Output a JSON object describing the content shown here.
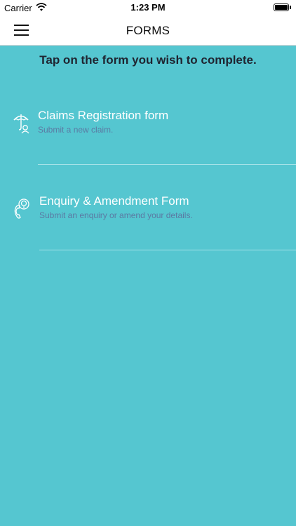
{
  "status_bar": {
    "carrier": "Carrier",
    "time": "1:23 PM",
    "wifi_icon": "wifi-icon",
    "battery_icon": "battery-icon"
  },
  "header": {
    "title": "FORMS",
    "menu_icon": "hamburger-menu-icon"
  },
  "main": {
    "instruction": "Tap on the form you wish to complete.",
    "forms": [
      {
        "title": "Claims Registration form",
        "subtitle": "Submit a new claim.",
        "icon": "umbrella-icon"
      },
      {
        "title": "Enquiry & Amendment Form",
        "subtitle": "Submit an enquiry or amend your details.",
        "icon": "phone-location-icon"
      }
    ]
  },
  "colors": {
    "background": "#55c6d0",
    "header_background": "#ffffff",
    "item_title": "#ffffff",
    "item_subtitle": "#5b7aa3",
    "instruction_text": "#1f2430"
  }
}
